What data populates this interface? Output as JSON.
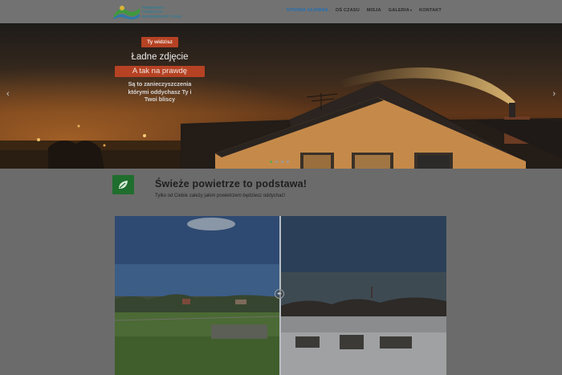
{
  "header": {
    "logo_lines": [
      "POMORSKA",
      "FUNDACJA",
      "EKOENERGETYCZNA"
    ],
    "nav": [
      {
        "label": "STRONA GŁÓWNA",
        "active": true
      },
      {
        "label": "OŚ CZASU",
        "active": false
      },
      {
        "label": "MISJA",
        "active": false
      },
      {
        "label": "GALERIA",
        "active": false,
        "dropdown": true
      },
      {
        "label": "KONTAKT",
        "active": false
      }
    ]
  },
  "hero": {
    "tag": "Ty widzisz",
    "title": "Ładne zdjęcie",
    "tag2": "A tak na prawdę",
    "body_lines": [
      "Są to zanieczyszczenia",
      "którymi oddychasz Ty i",
      "Twoi bliscy"
    ],
    "prev_arrow": "‹",
    "next_arrow": "›",
    "slides": 4,
    "active_slide": 1
  },
  "section": {
    "icon": "leaf-icon",
    "heading": "Świeże powietrze to podstawa!",
    "subheading": "Tylko od Ciebie zależy jakim powietrzem będziesz oddychać!"
  },
  "compare": {
    "handle_icon": "drag-arrows-icon",
    "handle_glyph": "◂▸"
  },
  "colors": {
    "accent_tag": "#b64224",
    "nav_active": "#1e6fb5",
    "leaf_box": "#1f6e2e",
    "dot_active": "#5cab4e"
  }
}
